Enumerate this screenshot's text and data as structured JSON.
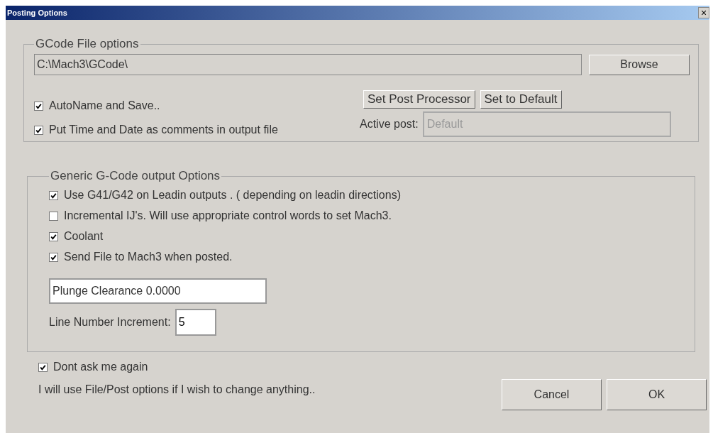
{
  "window": {
    "title": "Posting Options",
    "close": "×"
  },
  "gcode_file_options": {
    "legend": "GCode File options",
    "path": "C:\\Mach3\\GCode\\",
    "browse": "Browse",
    "checkboxes": [
      {
        "label": "AutoName and Save..",
        "checked": true
      },
      {
        "label": "Put Time and Date as comments in output file",
        "checked": true
      }
    ],
    "buttons": [
      "Set Post Processor",
      "Set to Default"
    ],
    "active_post": {
      "label": "Active post:",
      "value": "Default",
      "disabled": true
    }
  },
  "generic_options": {
    "legend": "Generic G-Code output Options",
    "checkboxes": [
      {
        "label": "Use G41/G42 on Leadin outputs . ( depending on leadin directions)",
        "checked": true
      },
      {
        "label": "Incremental IJ's. Will use appropriate control words to set Mach3.",
        "checked": false
      },
      {
        "label": "Coolant",
        "checked": true
      },
      {
        "label": "Send File to Mach3 when posted.",
        "checked": true
      }
    ],
    "plunge_clearance": "Plunge Clearance 0.0000",
    "line_number": {
      "label": "Line Number Increment:",
      "value": "5"
    }
  },
  "dont_ask": {
    "label": "Dont ask me again",
    "checked": true
  },
  "note": "I will use File/Post options if I wish to change anything..",
  "buttons": [
    "Cancel",
    "OK"
  ]
}
